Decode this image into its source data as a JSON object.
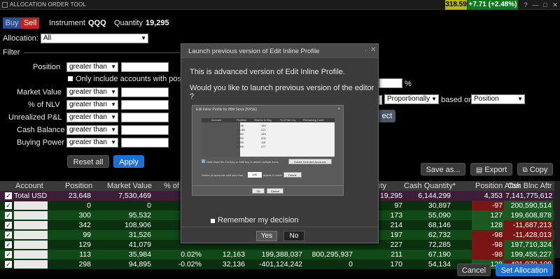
{
  "window": {
    "title": "ALLOCATION ORDER TOOL",
    "ticker_price": "318.59",
    "ticker_change": "+7.71 (+2.48%)",
    "price_color": "#b8b800",
    "change_color": "#0a7a1a"
  },
  "order": {
    "buy_label": "Buy",
    "sell_label": "Sell",
    "instrument_label": "Instrument",
    "instrument_value": "QQQ",
    "quantity_label": "Quantity",
    "quantity_value": "19,295"
  },
  "allocation": {
    "label": "Allocation:",
    "value": "All"
  },
  "filter": {
    "title": "Filter",
    "rows": [
      {
        "label": "Position",
        "op": "greater than"
      },
      {
        "label": "Market Value",
        "op": "greater than"
      },
      {
        "label": "% of NLV",
        "op": "greater than"
      },
      {
        "label": "Unrealized P&L",
        "op": "greater than"
      },
      {
        "label": "Cash Balance",
        "op": "greater than"
      },
      {
        "label": "Buying Power",
        "op": "greater than"
      }
    ],
    "only_include_label": "Only include accounts with positio",
    "percent_sign": "%",
    "method_value": "Proportionally",
    "based_on_label": "based on",
    "based_on_value": "Position",
    "select_partial": "ect",
    "reset_label": "Reset all",
    "apply_label": "Apply"
  },
  "toolbar": {
    "save_as_label": "Save as...",
    "export_label": "Export",
    "copy_label": "Copy"
  },
  "table": {
    "headers": {
      "account": "Account",
      "position": "Position",
      "market_value": "Market Value",
      "pct": "% of",
      "quantity_partial": "ity",
      "cash_quantity": "Cash Quantity*",
      "position_after": "Position After",
      "cash_blnc_after": "Csh Blnc Aftr"
    },
    "total": {
      "account": "Total USD",
      "position": "23,648",
      "market_value": "7,530,469",
      "quantity": "19,295",
      "cash_quantity": "6,144,299",
      "position_after": "4,353",
      "cash_blnc_after": "7,141,775,612"
    },
    "rows": [
      {
        "position": "0",
        "market_value": "0",
        "pct": "",
        "c4": "",
        "c5": "",
        "c6": "",
        "quantity": "97",
        "cash_quantity": "30,897",
        "position_after": "-97",
        "cash_blnc_after": "200,590,514",
        "after_neg": true,
        "cash_neg": false
      },
      {
        "position": "300",
        "market_value": "95,532",
        "pct": "",
        "c4": "",
        "c5": "",
        "c6": "",
        "quantity": "173",
        "cash_quantity": "55,090",
        "position_after": "127",
        "cash_blnc_after": "199,608,878",
        "after_neg": false,
        "cash_neg": false
      },
      {
        "position": "342",
        "market_value": "108,906",
        "pct": "",
        "c4": "",
        "c5": "",
        "c6": "",
        "quantity": "214",
        "cash_quantity": "68,146",
        "position_after": "128",
        "cash_blnc_after": "-11,687,213",
        "after_neg": false,
        "cash_neg": true
      },
      {
        "position": "99",
        "market_value": "31,526",
        "pct": "",
        "c4": "",
        "c5": "",
        "c6": "",
        "quantity": "197",
        "cash_quantity": "62,732",
        "position_after": "-98",
        "cash_blnc_after": "-11,428,013",
        "after_neg": true,
        "cash_neg": true
      },
      {
        "position": "129",
        "market_value": "41,079",
        "pct": "",
        "c4": "",
        "c5": "",
        "c6": "",
        "quantity": "227",
        "cash_quantity": "72,285",
        "position_after": "-98",
        "cash_blnc_after": "197,710,324",
        "after_neg": true,
        "cash_neg": false
      },
      {
        "position": "113",
        "market_value": "35,984",
        "pct": "0.02%",
        "c4": "12,163",
        "c5": "199,388,037",
        "c6": "800,295,937",
        "quantity": "211",
        "cash_quantity": "67,190",
        "position_after": "-98",
        "cash_blnc_after": "199,455,227",
        "after_neg": true,
        "cash_neg": false
      },
      {
        "position": "298",
        "market_value": "94,895",
        "pct": "-0.02%",
        "c4": "32,136",
        "c5": "-401,124,242",
        "c6": "0",
        "quantity": "170",
        "cash_quantity": "54,134",
        "position_after": "128",
        "cash_blnc_after": "-401,070,108",
        "after_neg": false,
        "cash_neg": true
      }
    ]
  },
  "footer": {
    "cancel_label": "Cancel",
    "set_allocation_label": "Set Allocation"
  },
  "modal": {
    "title": "Launch previous version of Edit Inline Profile",
    "dots": "·",
    "close": "✕",
    "message1": "This is advanced version of Edit Inline Profile.",
    "message2": "Would you like to launch previous version of the editor ?",
    "preview": {
      "title": "Edit Inline Profile for IBM Stock (NYSE)",
      "headers": [
        "Account",
        "Position",
        "Shares to Buy",
        "% of Net Liq",
        "Remaining Cash"
      ],
      "values": [
        "2,198",
        "14,080",
        "2,050",
        "2,290",
        "2,035",
        "2,008"
      ],
      "shares": [
        "150",
        "211",
        "183",
        "205",
        "118",
        "477"
      ],
      "hint": "Hold down the Ctrl key or Shift key to select multiple items",
      "delete_selected": "Delete Selected Accounts",
      "delete_less_label": "Delete all accounts with less than",
      "delete_less_value": "100",
      "shares_to_trade": "shares to trade",
      "delete_label": "Delete",
      "ok_label": "Ok",
      "cancel_label": "Cancel"
    },
    "remember_label": "Remember my decision",
    "yes_label": "Yes",
    "no_label": "No"
  }
}
